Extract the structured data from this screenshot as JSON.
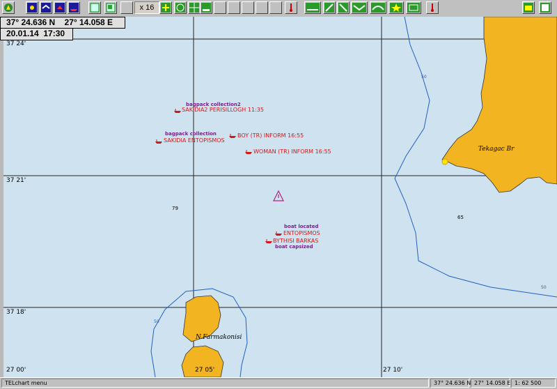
{
  "toolbar": {
    "zoom_label": "x 16",
    "buttons": [
      "compass-icon",
      "sun-icon",
      "bird-icon",
      "cloud-icon",
      "ship-icon",
      "overview-icon",
      "chart-icon",
      "blank",
      "blank",
      "zoom-in-icon",
      "globe-icon",
      "grid-icon",
      "scale-icon",
      "blank",
      "blank",
      "blank",
      "blank",
      "blank",
      "blank",
      "route-icon",
      "track-icon",
      "measure-icon",
      "line-icon",
      "curve-icon",
      "star-icon",
      "layers-icon",
      "alert-icon",
      "open-folder-icon",
      "save-icon"
    ]
  },
  "position": {
    "lat": "37° 24.636 N",
    "lon": "27° 14.058 E"
  },
  "datetime": "20.01.14  17:30",
  "grid_labels": {
    "lat_top": "37 24'",
    "lat_mid": "37 21'",
    "lat_low": "37 18'",
    "lon_left": "27 00'",
    "lon_mid": "27 05'",
    "lon_right": "27 10'"
  },
  "markers": [
    {
      "caption": "bagpack collection2",
      "label": "SAKIDIA2 PERISILLOGH 11:35"
    },
    {
      "caption": "bagpack collection",
      "label": "SAKIDIA ENTOPISMOS"
    },
    {
      "caption": "",
      "label": "BOY (TR) INFORM 16:55"
    },
    {
      "caption": "",
      "label": "WOMAN (TR) INFORM 16:55"
    },
    {
      "caption": "boat located",
      "label": "ENTOPISMOS"
    },
    {
      "caption": "boat  capsized",
      "label": "BYTHISI BARKAS"
    }
  ],
  "places": {
    "east": "Tekagac Br",
    "island": "N.Farmakonisi"
  },
  "depths": {
    "d1": "79",
    "d2": "65"
  },
  "contours": {
    "c1": "50",
    "c2": "50",
    "c3": "50"
  },
  "statusbar": {
    "menu": "TELchart menu",
    "lat": "37° 24.636 N",
    "lon": "27° 14.058 E",
    "scale": "1: 62 500"
  },
  "colors": {
    "sea": "#cfe2ef",
    "land": "#f2b521",
    "marker": "#cc1a1a",
    "caption": "#7a1e8c",
    "contour": "#2060c0"
  }
}
